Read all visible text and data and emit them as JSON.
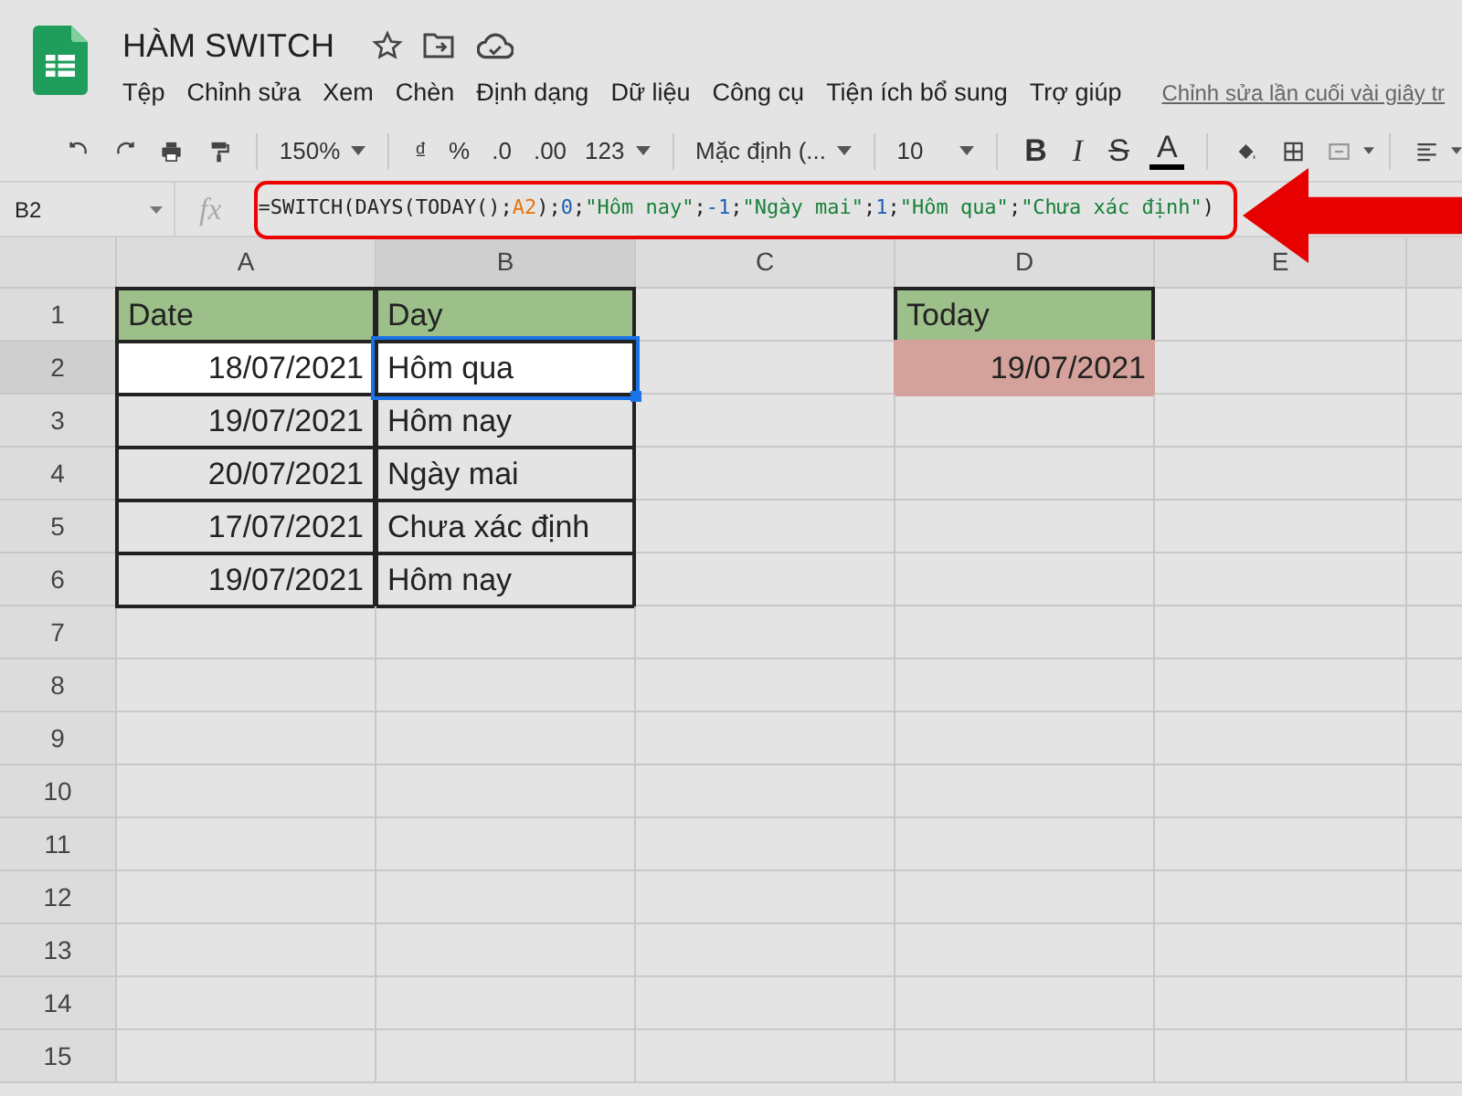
{
  "document": {
    "title": "HÀM SWITCH",
    "last_edit": "Chỉnh sửa lần cuối vài giây tr"
  },
  "menus": [
    "Tệp",
    "Chỉnh sửa",
    "Xem",
    "Chèn",
    "Định dạng",
    "Dữ liệu",
    "Công cụ",
    "Tiện ích bổ sung",
    "Trợ giúp"
  ],
  "toolbar": [
    {
      "kind": "undo"
    },
    {
      "kind": "redo"
    },
    {
      "kind": "print"
    },
    {
      "kind": "paint"
    },
    {
      "kind": "sep"
    },
    {
      "kind": "zoom",
      "label": "150%"
    },
    {
      "kind": "sep"
    },
    {
      "kind": "text",
      "label": "₫"
    },
    {
      "kind": "text",
      "label": "%"
    },
    {
      "kind": "text",
      "label": ".0"
    },
    {
      "kind": "text",
      "label": ".00"
    },
    {
      "kind": "dropdown",
      "label": "123"
    },
    {
      "kind": "sep"
    },
    {
      "kind": "font",
      "label": "Mặc định (..."
    },
    {
      "kind": "sep"
    },
    {
      "kind": "size",
      "label": "10"
    },
    {
      "kind": "sep"
    },
    {
      "kind": "bold",
      "label": "B"
    },
    {
      "kind": "italic",
      "label": "I"
    },
    {
      "kind": "strike",
      "label": "S"
    },
    {
      "kind": "color",
      "label": "A"
    },
    {
      "kind": "sep"
    },
    {
      "kind": "fill"
    },
    {
      "kind": "borders"
    },
    {
      "kind": "merge"
    },
    {
      "kind": "sep"
    },
    {
      "kind": "align"
    }
  ],
  "formula_bar": {
    "cell_ref": "B2",
    "fx": "fx",
    "formula": [
      {
        "kind": "plain",
        "text": "=SWITCH(DAYS(TODAY();"
      },
      {
        "kind": "ref",
        "text": "A2"
      },
      {
        "kind": "plain",
        "text": ");"
      },
      {
        "kind": "number",
        "text": "0"
      },
      {
        "kind": "plain",
        "text": ";"
      },
      {
        "kind": "string",
        "text": "\"Hôm nay\""
      },
      {
        "kind": "plain",
        "text": ";"
      },
      {
        "kind": "number",
        "text": "-1"
      },
      {
        "kind": "plain",
        "text": ";"
      },
      {
        "kind": "string",
        "text": "\"Ngày mai\""
      },
      {
        "kind": "plain",
        "text": ";"
      },
      {
        "kind": "number",
        "text": "1"
      },
      {
        "kind": "plain",
        "text": ";"
      },
      {
        "kind": "string",
        "text": "\"Hôm qua\""
      },
      {
        "kind": "plain",
        "text": ";"
      },
      {
        "kind": "string",
        "text": "\"Chưa xác định\""
      },
      {
        "kind": "plain",
        "text": ")"
      }
    ]
  },
  "sheet": {
    "columns": [
      {
        "label": "A",
        "selected": false
      },
      {
        "label": "B",
        "selected": true
      },
      {
        "label": "C",
        "selected": false
      },
      {
        "label": "D",
        "selected": false
      },
      {
        "label": "E",
        "selected": false
      }
    ],
    "rows": [
      {
        "label": "1",
        "selected": false,
        "cells": [
          {
            "kind": "header",
            "text": "Date"
          },
          {
            "kind": "header",
            "text": "Day"
          },
          null,
          {
            "kind": "header",
            "text": "Today"
          }
        ]
      },
      {
        "label": "2",
        "selected": true,
        "cells": [
          {
            "kind": "date",
            "text": "18/07/2021"
          },
          {
            "kind": "text",
            "text": "Hôm qua",
            "selected": true
          },
          null,
          {
            "kind": "today",
            "text": "19/07/2021"
          }
        ]
      },
      {
        "label": "3",
        "selected": false,
        "cells": [
          {
            "kind": "date",
            "text": "19/07/2021"
          },
          {
            "kind": "text",
            "text": "Hôm nay"
          }
        ]
      },
      {
        "label": "4",
        "selected": false,
        "cells": [
          {
            "kind": "date",
            "text": "20/07/2021"
          },
          {
            "kind": "text",
            "text": "Ngày mai"
          }
        ]
      },
      {
        "label": "5",
        "selected": false,
        "cells": [
          {
            "kind": "date",
            "text": "17/07/2021"
          },
          {
            "kind": "text",
            "text": "Chưa xác định"
          }
        ]
      },
      {
        "label": "6",
        "selected": false,
        "cells": [
          {
            "kind": "date",
            "text": "19/07/2021"
          },
          {
            "kind": "text",
            "text": "Hôm nay"
          }
        ]
      },
      {
        "label": "7",
        "selected": false
      },
      {
        "label": "8",
        "selected": false
      },
      {
        "label": "9",
        "selected": false
      },
      {
        "label": "10",
        "selected": false
      },
      {
        "label": "11",
        "selected": false
      },
      {
        "label": "12",
        "selected": false
      },
      {
        "label": "13",
        "selected": false
      },
      {
        "label": "14",
        "selected": false
      },
      {
        "label": "15",
        "selected": false
      }
    ]
  }
}
